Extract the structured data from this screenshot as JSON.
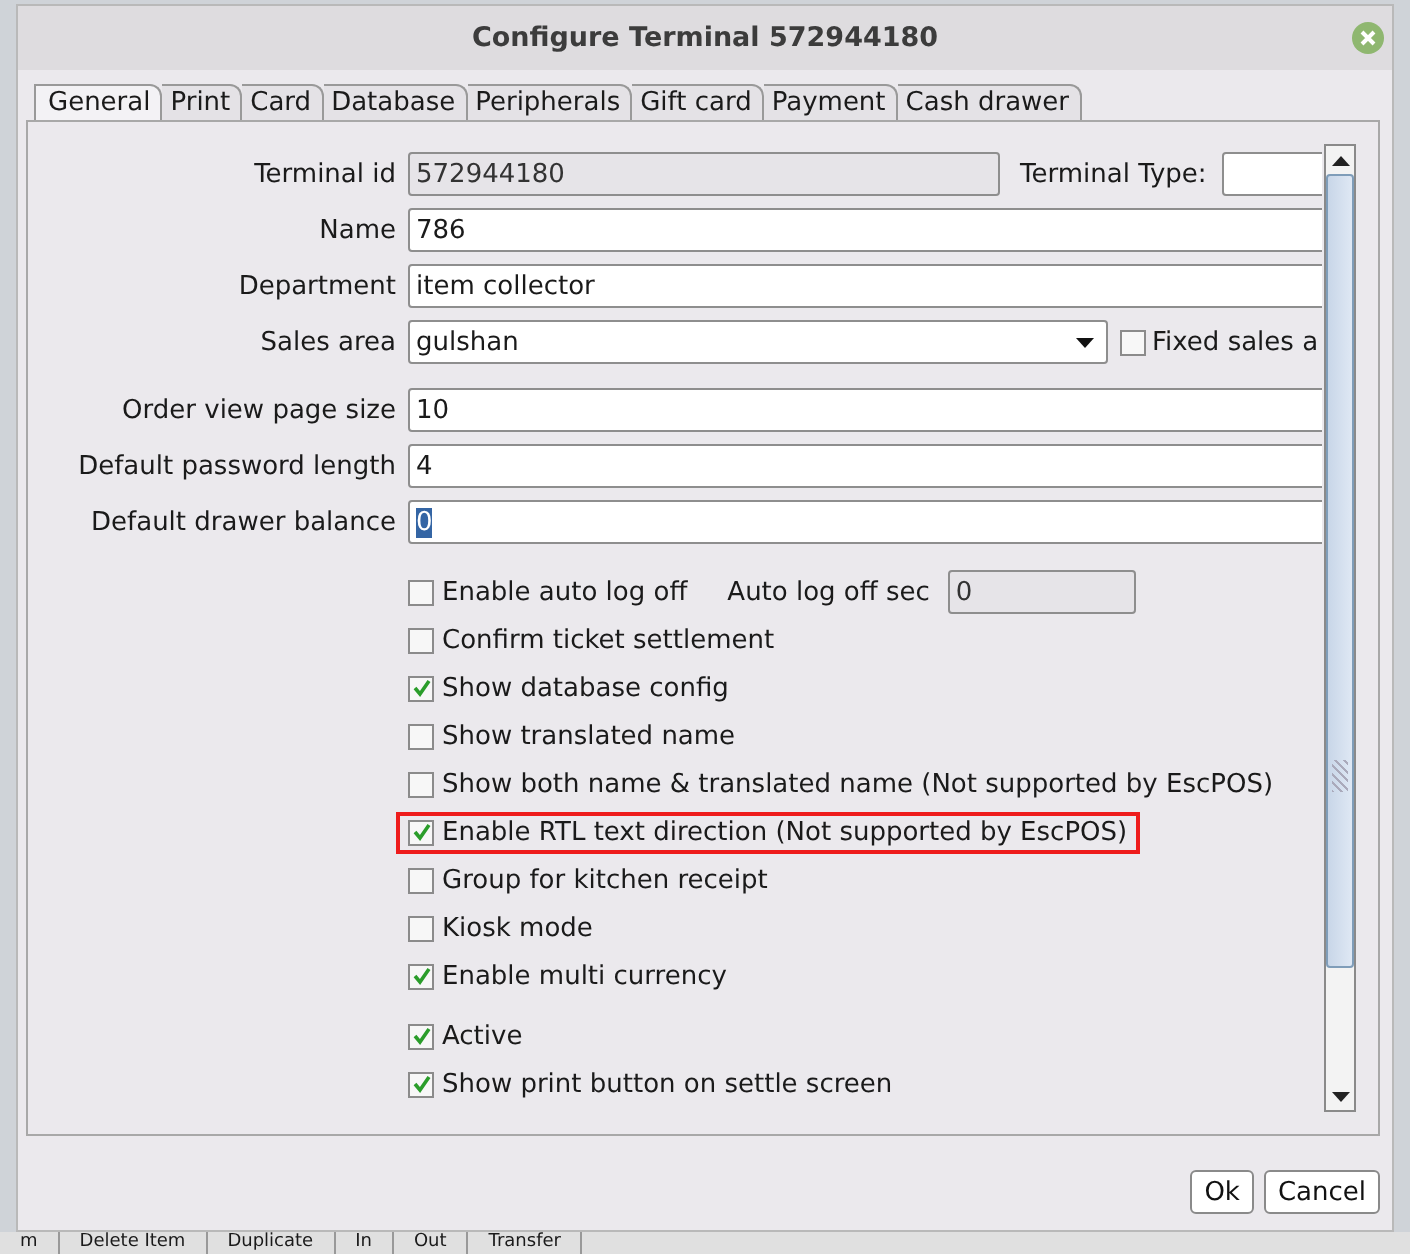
{
  "window": {
    "title": "Configure Terminal 572944180"
  },
  "tabs": [
    {
      "label": "General",
      "selected": true
    },
    {
      "label": "Print",
      "selected": false
    },
    {
      "label": "Card",
      "selected": false
    },
    {
      "label": "Database",
      "selected": false
    },
    {
      "label": "Peripherals",
      "selected": false
    },
    {
      "label": "Gift card",
      "selected": false
    },
    {
      "label": "Payment",
      "selected": false
    },
    {
      "label": "Cash drawer",
      "selected": false
    }
  ],
  "field_groups": [
    [
      {
        "kind": "text",
        "label": "Terminal id",
        "value": "572944180",
        "disabled": true,
        "value_selected": false,
        "side": {
          "kind": "text",
          "label": "Terminal Type:"
        }
      },
      {
        "kind": "text",
        "label": "Name",
        "value": "786",
        "disabled": false,
        "value_selected": false
      },
      {
        "kind": "text",
        "label": "Department",
        "value": "item collector",
        "disabled": false,
        "value_selected": false
      },
      {
        "kind": "combo",
        "label": "Sales area",
        "value": "gulshan",
        "disabled": false,
        "value_selected": false,
        "side": {
          "kind": "checkbox",
          "label": "Fixed sales a",
          "checked": false
        }
      }
    ],
    [
      {
        "kind": "text",
        "label": "Order view page size",
        "value": "10",
        "disabled": false,
        "value_selected": false
      },
      {
        "kind": "text",
        "label": "Default password length",
        "value": "4",
        "disabled": false,
        "value_selected": false
      },
      {
        "kind": "text",
        "label": "Default drawer balance",
        "value": "0",
        "disabled": false,
        "value_selected": true
      }
    ]
  ],
  "option_groups": [
    [
      {
        "label": "Enable auto log off",
        "checked": false,
        "highlighted": false,
        "side": {
          "label": "Auto log off sec",
          "value": "0",
          "disabled": true
        }
      },
      {
        "label": "Confirm ticket settlement",
        "checked": false,
        "highlighted": false
      },
      {
        "label": "Show database config",
        "checked": true,
        "highlighted": false
      },
      {
        "label": "Show translated name",
        "checked": false,
        "highlighted": false
      },
      {
        "label": "Show both name & translated name (Not supported by EscPOS)",
        "checked": false,
        "highlighted": false
      },
      {
        "label": "Enable RTL text direction (Not supported by EscPOS)",
        "checked": true,
        "highlighted": true
      },
      {
        "label": "Group for kitchen receipt",
        "checked": false,
        "highlighted": false
      },
      {
        "label": "Kiosk mode",
        "checked": false,
        "highlighted": false
      },
      {
        "label": "Enable multi currency",
        "checked": true,
        "highlighted": false
      }
    ],
    [
      {
        "label": "Active",
        "checked": true,
        "highlighted": false
      },
      {
        "label": "Show print button on settle screen",
        "checked": true,
        "highlighted": false
      }
    ]
  ],
  "buttons": [
    {
      "label": "Ok"
    },
    {
      "label": "Cancel"
    }
  ],
  "background_toolbar": [
    "m",
    "Delete Item",
    "Duplicate",
    "In",
    "Out",
    "Transfer"
  ]
}
